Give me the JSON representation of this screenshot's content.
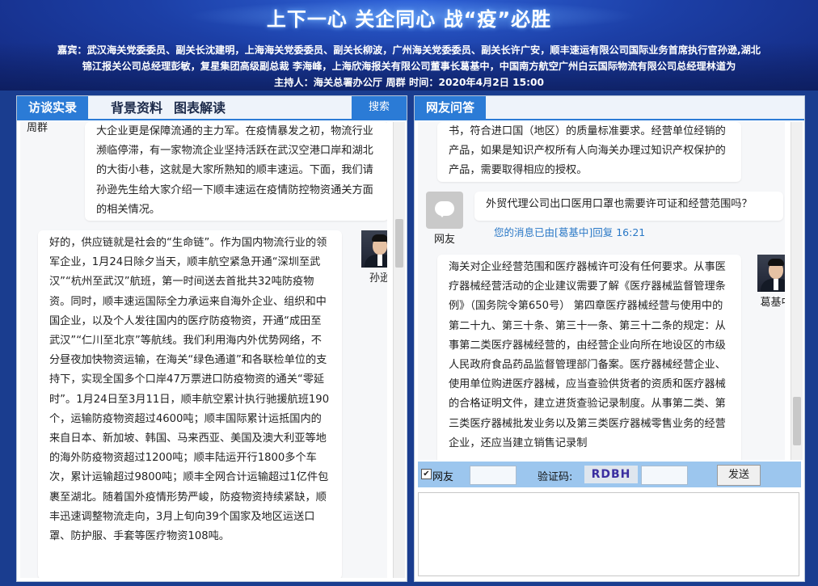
{
  "header": {
    "title": "上下一心 关企同心 战“疫”必胜",
    "guests_label": "嘉宾：",
    "guests_line1": "武汉海关党委委员、副关长沈建明，上海海关党委委员、副关长柳波，广州海关党委委员、副关长许广安，顺丰速运有限公司国际业务首席执行官孙逊,湖北",
    "guests_line2": "锦江报关公司总经理彭敏，复星集团高级副总裁 李海峰，上海欣海报关有限公司董事长葛基中，中国南方航空广州白云国际物流有限公司总经理林道为",
    "host": "主持人：海关总署办公厅 周群   时间：2020年4月2日 15:00"
  },
  "left_panel": {
    "tabs": [
      "访谈实录",
      "背景资料",
      "图表解读"
    ],
    "search_label": "搜索",
    "host_name_partial": "周群",
    "host_message": "大企业更是保障流通的主力军。在疫情暴发之初，物流行业濒临停滞，有一家物流企业坚持活跃在武汉空港口岸和湖北的大街小巷，这就是大家所熟知的顺丰速运。下面，我们请孙逊先生给大家介绍一下顺丰速运在疫情防控物资通关方面的相关情况。",
    "speaker_name": "孙逊",
    "speaker_message": "好的，供应链就是社会的“生命链”。作为国内物流行业的领军企业，1月24日除夕当天，顺丰航空紧急开通“深圳至武汉”“杭州至武汉”航班，第一时间送去首批共32吨防疫物资。同时，顺丰速运国际全力承运来自海外企业、组织和中国企业，以及个人发往国内的医疗防疫物资，开通“成田至武汉”“仁川至北京”等航线。我们利用海内外优势网络，不分昼夜加快物资运输，在海关“绿色通道”和各联检单位的支持下，实现全国多个口岸47万票进口防疫物资的通关“零延时”。1月24日至3月11日，顺丰航空累计执行驰援航班190个，运输防疫物资超过4600吨；顺丰国际累计运抵国内的来自日本、新加坡、韩国、马来西亚、美国及澳大利亚等地的海外防疫物资超过1200吨；顺丰陆运开行1800多个车次，累计运输超过9800吨；顺丰全网合计运输超过1亿件包裹至湖北。随着国外疫情形势严峻，防疫物资持续紧缺，顺丰迅速调整物流走向，3月上旬向39个国家及地区运送口罩、防护服、手套等医疗物资108吨。"
  },
  "right_panel": {
    "tab": "网友问答",
    "prev_answer": "书，符合进口国（地区）的质量标准要求。经营单位经销的产品，如果是知识产权所有人向海关办理过知识产权保护的产品，需要取得相应的授权。",
    "question_user": "网友",
    "question": "外贸代理公司出口医用口罩也需要许可证和经营范围吗？",
    "reply_note": "您的消息已由[葛基中]回复 16:21",
    "answer_name": "葛基中",
    "answer": "海关对企业经营范围和医疗器械许可没有任何要求。从事医疗器械经营活动的企业建议需要了解《医疗器械监督管理条例》（国务院令第650号） 第四章医疗器械经营与使用中的第二十九、第三十条、第三十一条、第三十二条的规定：从事第二类医疗器械经营的，由经营企业向所在地设区的市级人民政府食品药品监督管理部门备案。医疗器械经营企业、使用单位购进医疗器械，应当查验供货者的资质和医疗器械的合格证明文件，建立进货查验记录制度。从事第二类、第三类医疗器械批发业务以及第三类医疗器械零售业务的经营企业，还应当建立销售记录制",
    "form": {
      "checkbox_label": "网友",
      "captcha_label": "验证码:",
      "captcha": "RDBH",
      "send_label": "发送"
    }
  }
}
